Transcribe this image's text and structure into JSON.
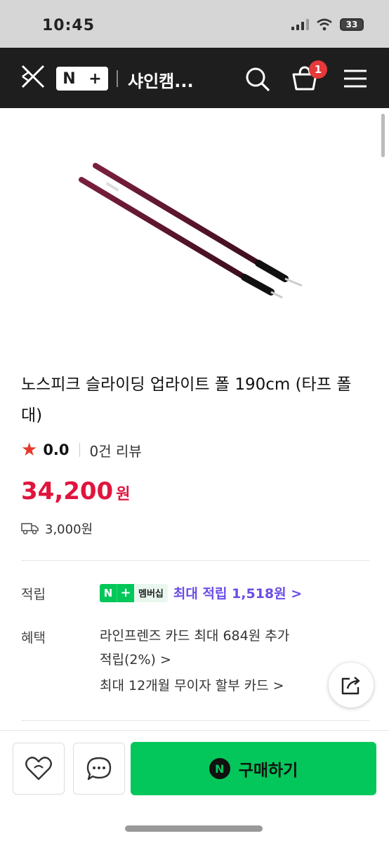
{
  "status_bar": {
    "time": "10:45",
    "battery": "33"
  },
  "header": {
    "store_name": "샤인캠...",
    "cart_count": "1",
    "logo": "N+"
  },
  "product": {
    "title": "노스피크 슬라이딩 업라이트 폴 190cm (타프 폴대)",
    "rating": "0.0",
    "review_count": "0건 리뷰",
    "price": "34,200",
    "currency": "원",
    "shipping_fee": "3,000원"
  },
  "points": {
    "label": "적립",
    "badge_text": "멤버십",
    "text": "최대 적립 1,518원 >"
  },
  "benefits": {
    "label": "혜택",
    "card_line1": "라인프렌즈 카드 최대 684원 추가",
    "card_line2": "적립(2%) >",
    "installment": "최대 12개월 무이자 할부 카드 >"
  },
  "bottom_bar": {
    "buy_label": "구매하기"
  },
  "colors": {
    "price": "#e0143c",
    "brand_green": "#03c75a",
    "points_purple": "#6b4ce6",
    "header_bg": "#1e1e1e"
  }
}
